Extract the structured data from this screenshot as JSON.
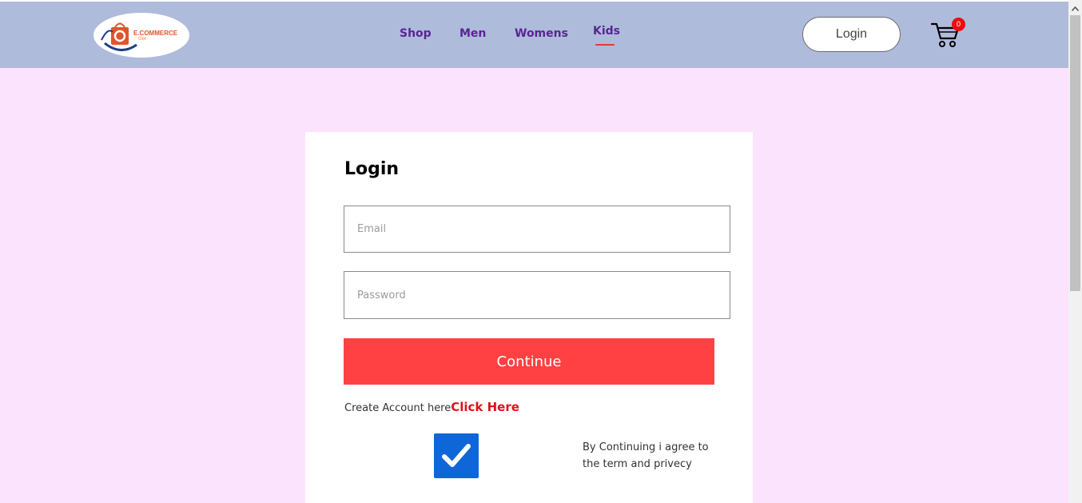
{
  "header": {
    "logo": {
      "text": "E.COMMERCE",
      "sub": "Get"
    },
    "nav": [
      {
        "label": "Shop"
      },
      {
        "label": "Men"
      },
      {
        "label": "Womens"
      },
      {
        "label": "Kids",
        "active": true
      }
    ],
    "login_label": "Login",
    "cart_count": "0"
  },
  "form": {
    "title": "Login",
    "email_placeholder": "Email",
    "password_placeholder": "Password",
    "continue_label": "Continue",
    "create_account_text": "Create Account here",
    "click_here_label": "Click Here",
    "agree_text": "By Continuing i agree to the term and privecy",
    "agree_checked": true
  },
  "colors": {
    "navbar_bg": "#aebbdb",
    "page_bg": "#fbe3fd",
    "nav_text": "#5a2593",
    "continue_bg": "#ff4144",
    "link_red": "#e0101a",
    "checkbox_bg": "#0f66d8"
  },
  "icons": {
    "cart": "shopping-cart-icon",
    "logo": "shopping-bag-logo",
    "checkbox": "checkmark-icon"
  }
}
